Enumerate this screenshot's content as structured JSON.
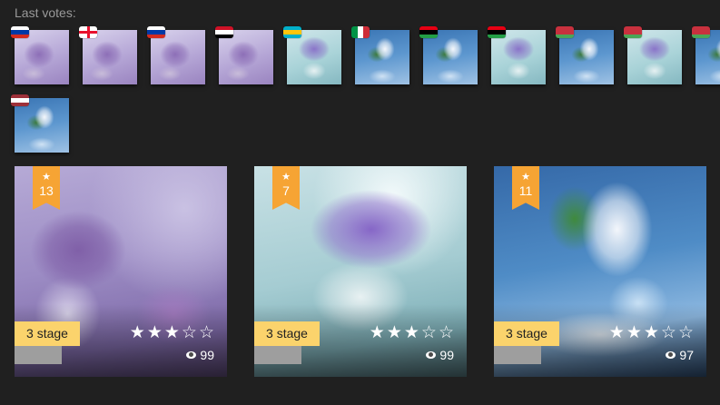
{
  "votes_label": "Last votes:",
  "votes": [
    {
      "flag_icon": "russia-flag-icon",
      "flag_colors": [
        "#ffffff",
        "#0039a6",
        "#d52b1e"
      ],
      "orientation": "horizontal",
      "thumb": "purple"
    },
    {
      "flag_icon": "georgia-flag-icon",
      "flag_colors": [
        "#ffffff",
        "#e8112d",
        "#ffffff"
      ],
      "orientation": "cross",
      "thumb": "purple"
    },
    {
      "flag_icon": "russia-flag-icon",
      "flag_colors": [
        "#ffffff",
        "#0039a6",
        "#d52b1e"
      ],
      "orientation": "horizontal",
      "thumb": "purple"
    },
    {
      "flag_icon": "iraq-flag-icon",
      "flag_colors": [
        "#ce1126",
        "#ffffff",
        "#000000"
      ],
      "orientation": "horizontal",
      "thumb": "purple"
    },
    {
      "flag_icon": "kazakhstan-flag-icon",
      "flag_colors": [
        "#00afca",
        "#fec50c",
        "#00afca"
      ],
      "orientation": "horizontal",
      "thumb": "mint"
    },
    {
      "flag_icon": "italy-flag-icon",
      "flag_colors": [
        "#009246",
        "#ffffff",
        "#ce2b37"
      ],
      "orientation": "vertical",
      "thumb": "blue"
    },
    {
      "flag_icon": "libya-flag-icon",
      "flag_colors": [
        "#e70013",
        "#000000",
        "#239e46"
      ],
      "orientation": "horizontal",
      "thumb": "blue"
    },
    {
      "flag_icon": "libya-flag-icon",
      "flag_colors": [
        "#e70013",
        "#000000",
        "#239e46"
      ],
      "orientation": "horizontal",
      "thumb": "mint"
    },
    {
      "flag_icon": "belarus-flag-icon",
      "flag_colors": [
        "#c8313e",
        "#c8313e",
        "#4aa657"
      ],
      "orientation": "horizontal",
      "thumb": "blue"
    },
    {
      "flag_icon": "belarus-flag-icon",
      "flag_colors": [
        "#c8313e",
        "#c8313e",
        "#4aa657"
      ],
      "orientation": "horizontal",
      "thumb": "mint"
    },
    {
      "flag_icon": "belarus-flag-icon",
      "flag_colors": [
        "#c8313e",
        "#c8313e",
        "#4aa657"
      ],
      "orientation": "horizontal",
      "thumb": "blue"
    },
    {
      "flag_icon": "latvia-flag-icon",
      "flag_colors": [
        "#9e3039",
        "#ffffff",
        "#9e3039"
      ],
      "orientation": "horizontal",
      "thumb": "blue"
    }
  ],
  "cards": [
    {
      "rank": "13",
      "stage": "3 stage",
      "rating": 3,
      "max_rating": 5,
      "views": "99"
    },
    {
      "rank": "7",
      "stage": "3 stage",
      "rating": 3,
      "max_rating": 5,
      "views": "99"
    },
    {
      "rank": "11",
      "stage": "3 stage",
      "rating": 3,
      "max_rating": 5,
      "views": "97"
    }
  ]
}
